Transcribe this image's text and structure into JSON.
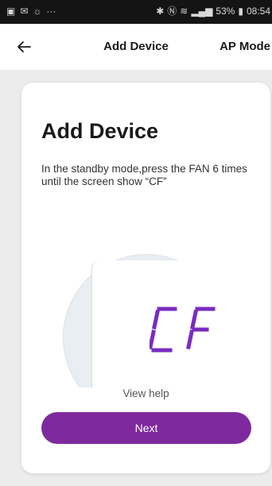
{
  "status_bar": {
    "left_icons": [
      "gallery-icon",
      "mail-icon",
      "brightness-icon",
      "more-dots-icon"
    ],
    "right_icons": [
      "bluetooth-icon",
      "nfc-icon",
      "wifi-icon",
      "signal-icon"
    ],
    "battery": "53%",
    "time": "08:54"
  },
  "nav": {
    "back_icon": "back-arrow-icon",
    "title": "Add Device",
    "action": "AP Mode"
  },
  "card": {
    "title": "Add Device",
    "description": "In the standby mode,press the FAN 6 times\nuntil the screen show “CF”",
    "display_code": "CF",
    "view_help": "View help",
    "next_label": "Next"
  },
  "colors": {
    "accent": "#7e2a9e",
    "lcd_purple": "#7a2bc0"
  }
}
